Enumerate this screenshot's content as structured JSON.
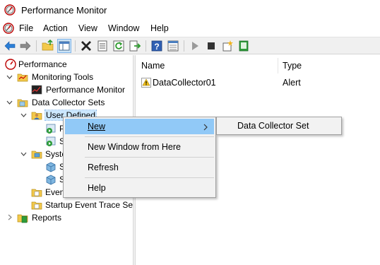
{
  "window": {
    "title": "Performance Monitor"
  },
  "menu": {
    "items": [
      "File",
      "Action",
      "View",
      "Window",
      "Help"
    ]
  },
  "toolbar": {
    "buttons": [
      "back-icon",
      "forward-icon",
      "up-folder-icon",
      "show-hide-tree-icon",
      "delete-icon",
      "properties-icon",
      "refresh-icon",
      "export-icon",
      "help-icon",
      "view-icon",
      "start-icon",
      "stop-icon",
      "new-icon",
      "report-icon"
    ]
  },
  "tree": {
    "root": "Performance",
    "monitoring_tools": "Monitoring Tools",
    "performance_monitor": "Performance Monitor",
    "data_collector_sets": "Data Collector Sets",
    "user_defined": "User Defined",
    "user_child_1": "P",
    "user_child_2": "S",
    "system": "Syste",
    "system_child_1": "S",
    "system_child_2": "S",
    "event_trace": "Even",
    "startup_event": "Startup Event Trace Ses",
    "reports": "Reports"
  },
  "list": {
    "columns": [
      "Name",
      "Type"
    ],
    "rows": [
      {
        "name": "DataCollector01",
        "type": "Alert"
      }
    ]
  },
  "context_menu": {
    "items": [
      "New",
      "New Window from Here",
      "Refresh",
      "Help"
    ],
    "submenu_arrow": "›"
  },
  "submenu": {
    "items": [
      "Data Collector Set"
    ]
  },
  "colors": {
    "highlight": "#91c9f7",
    "selection": "#cce8ff",
    "toolbar": "#f0f0f0",
    "menu_bg": "#f2f2f2"
  }
}
